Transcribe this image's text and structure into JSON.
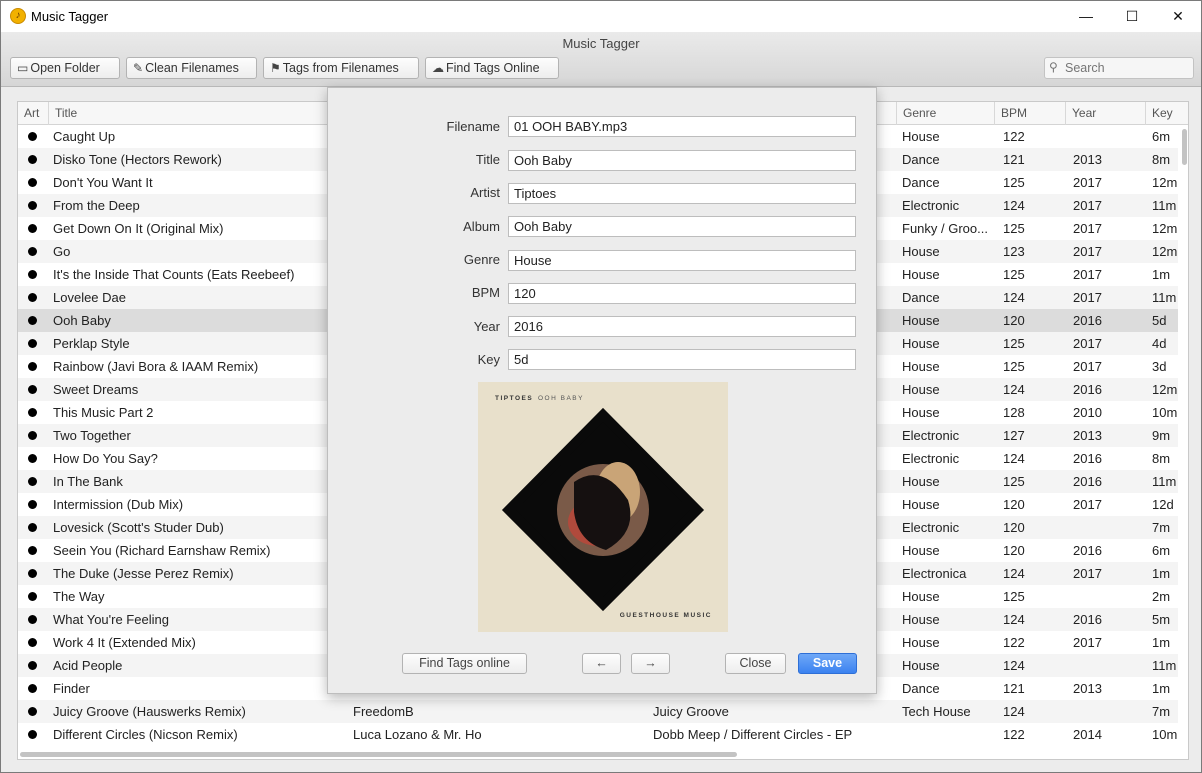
{
  "window": {
    "title": "Music Tagger",
    "minimize": "—",
    "maximize": "☐",
    "close": "✕"
  },
  "toolbar": {
    "title": "Music Tagger",
    "open_folder": "Open Folder",
    "clean_filenames": "Clean Filenames",
    "tags_from_filenames": "Tags from Filenames",
    "find_tags_online": "Find Tags Online",
    "search_placeholder": "Search"
  },
  "table": {
    "columns": {
      "art": "Art",
      "title": "Title",
      "genre": "Genre",
      "bpm": "BPM",
      "year": "Year",
      "key": "Key"
    },
    "rows": [
      {
        "title": "Caught Up",
        "artist": "",
        "album": "",
        "genre": "House",
        "bpm": "122",
        "year": "",
        "key": "6m"
      },
      {
        "title": "Disko Tone (Hectors Rework)",
        "artist": "",
        "album": "",
        "genre": "Dance",
        "bpm": "121",
        "year": "2013",
        "key": "8m"
      },
      {
        "title": "Don't You Want It",
        "artist": "",
        "album": "",
        "genre": "Dance",
        "bpm": "125",
        "year": "2017",
        "key": "12m"
      },
      {
        "title": "From the Deep",
        "artist": "",
        "album": "",
        "genre": "Electronic",
        "bpm": "124",
        "year": "2017",
        "key": "11m"
      },
      {
        "title": "Get Down On It (Original Mix)",
        "artist": "",
        "album": "",
        "genre": "Funky / Groo...",
        "bpm": "125",
        "year": "2017",
        "key": "12m"
      },
      {
        "title": "Go",
        "artist": "",
        "album": "",
        "genre": "House",
        "bpm": "123",
        "year": "2017",
        "key": "12m"
      },
      {
        "title": "It's the Inside That Counts (Eats Reebeef)",
        "artist": "",
        "album": "",
        "genre": "House",
        "bpm": "125",
        "year": "2017",
        "key": "1m"
      },
      {
        "title": "Lovelee Dae",
        "artist": "",
        "album": "",
        "genre": "Dance",
        "bpm": "124",
        "year": "2017",
        "key": "11m"
      },
      {
        "title": "Ooh Baby",
        "artist": "",
        "album": "",
        "genre": "House",
        "bpm": "120",
        "year": "2016",
        "key": "5d"
      },
      {
        "title": "Perklap Style",
        "artist": "",
        "album": "",
        "genre": "House",
        "bpm": "125",
        "year": "2017",
        "key": "4d"
      },
      {
        "title": "Rainbow (Javi Bora & IAAM Remix)",
        "artist": "",
        "album": "",
        "genre": "House",
        "bpm": "125",
        "year": "2017",
        "key": "3d"
      },
      {
        "title": "Sweet Dreams",
        "artist": "",
        "album": "",
        "genre": "House",
        "bpm": "124",
        "year": "2016",
        "key": "12m"
      },
      {
        "title": "This Music Part 2",
        "artist": "",
        "album": "",
        "genre": "House",
        "bpm": "128",
        "year": "2010",
        "key": "10m"
      },
      {
        "title": "Two Together",
        "artist": "",
        "album": "",
        "genre": "Electronic",
        "bpm": "127",
        "year": "2013",
        "key": "9m"
      },
      {
        "title": "How Do You Say?",
        "artist": "",
        "album": "",
        "genre": "Electronic",
        "bpm": "124",
        "year": "2016",
        "key": "8m"
      },
      {
        "title": "In The Bank",
        "artist": "",
        "album": "",
        "genre": "House",
        "bpm": "125",
        "year": "2016",
        "key": "11m"
      },
      {
        "title": "Intermission (Dub Mix)",
        "artist": "",
        "album": "",
        "genre": "House",
        "bpm": "120",
        "year": "2017",
        "key": "12d"
      },
      {
        "title": "Lovesick (Scott's Studer Dub)",
        "artist": "",
        "album": "",
        "genre": "Electronic",
        "bpm": "120",
        "year": "",
        "key": "7m"
      },
      {
        "title": "Seein You (Richard Earnshaw Remix)",
        "artist": "",
        "album": "..",
        "genre": "House",
        "bpm": "120",
        "year": "2016",
        "key": "6m"
      },
      {
        "title": "The Duke (Jesse Perez Remix)",
        "artist": "",
        "album": "",
        "genre": "Electronica",
        "bpm": "124",
        "year": "2017",
        "key": "1m"
      },
      {
        "title": "The Way",
        "artist": "",
        "album": "",
        "genre": "House",
        "bpm": "125",
        "year": "",
        "key": "2m"
      },
      {
        "title": "What You're Feeling",
        "artist": "",
        "album": "",
        "genre": "House",
        "bpm": "124",
        "year": "2016",
        "key": "5m"
      },
      {
        "title": "Work 4 It (Extended Mix)",
        "artist": "",
        "album": "",
        "genre": "House",
        "bpm": "122",
        "year": "2017",
        "key": "1m"
      },
      {
        "title": "Acid People",
        "artist": "",
        "album": "",
        "genre": "House",
        "bpm": "124",
        "year": "",
        "key": "11m"
      },
      {
        "title": "Finder",
        "artist": "",
        "album": "",
        "genre": "Dance",
        "bpm": "121",
        "year": "2013",
        "key": "1m"
      },
      {
        "title": "Juicy Groove (Hauswerks Remix)",
        "artist": "FreedomB",
        "album": "Juicy Groove",
        "genre": "Tech House",
        "bpm": "124",
        "year": "",
        "key": "7m"
      },
      {
        "title": "Different Circles (Nicson Remix)",
        "artist": "Luca Lozano & Mr. Ho",
        "album": "Dobb Meep / Different Circles - EP",
        "genre": "",
        "bpm": "122",
        "year": "2014",
        "key": "10m"
      }
    ]
  },
  "editor": {
    "labels": {
      "filename": "Filename",
      "title": "Title",
      "artist": "Artist",
      "album": "Album",
      "genre": "Genre",
      "bpm": "BPM",
      "year": "Year",
      "key": "Key"
    },
    "values": {
      "filename": "01 OOH BABY.mp3",
      "title": "Ooh Baby",
      "artist": "Tiptoes",
      "album": "Ooh Baby",
      "genre": "House",
      "bpm": "120",
      "year": "2016",
      "key": "5d"
    },
    "artwork": {
      "artist_text": "TIPTOES",
      "title_text": "OOH BABY",
      "label_text": "GUESTHOUSE MUSIC"
    },
    "buttons": {
      "find_online": "Find Tags online",
      "prev": "←",
      "next": "→",
      "close": "Close",
      "save": "Save"
    }
  }
}
